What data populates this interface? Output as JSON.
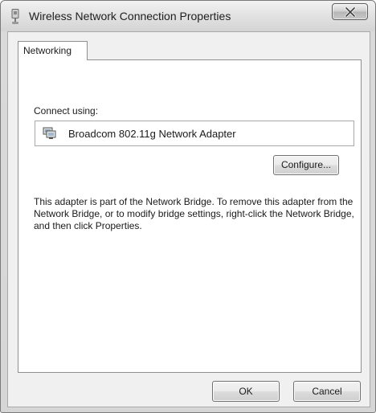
{
  "window": {
    "title": "Wireless Network Connection Properties"
  },
  "tabs": [
    {
      "label": "Networking",
      "selected": true
    }
  ],
  "networking": {
    "connect_using_label": "Connect using:",
    "adapter_name": "Broadcom 802.11g Network Adapter",
    "configure_label": "Configure...",
    "info_text": "This adapter is part of the Network Bridge.  To remove this adapter from the Network Bridge, or to modify bridge settings, right-click the Network Bridge, and then click Properties."
  },
  "footer": {
    "ok_label": "OK",
    "cancel_label": "Cancel"
  },
  "icons": {
    "title": "network-connection-icon",
    "adapter": "network-adapter-icon",
    "close": "close-icon"
  }
}
